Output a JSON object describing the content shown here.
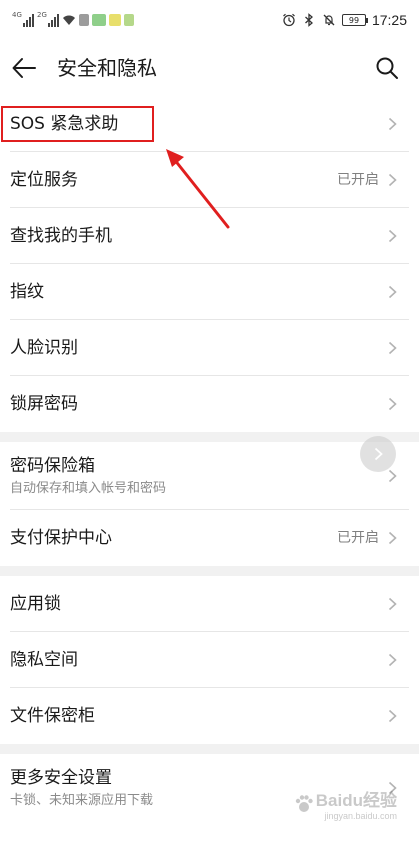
{
  "status_bar": {
    "sim1_tag": "4G",
    "sim2_tag": "2G",
    "battery": "99",
    "time": "17:25",
    "icons": [
      "alarm-icon",
      "bluetooth-icon",
      "mute-icon",
      "battery-icon"
    ]
  },
  "header": {
    "title": "安全和隐私",
    "back_icon": "arrow-left-icon",
    "search_icon": "search-icon"
  },
  "sections": [
    {
      "items": [
        {
          "label": "SOS 紧急求助",
          "value": "",
          "sub": ""
        },
        {
          "label": "定位服务",
          "value": "已开启",
          "sub": ""
        },
        {
          "label": "查找我的手机",
          "value": "",
          "sub": ""
        },
        {
          "label": "指纹",
          "value": "",
          "sub": ""
        },
        {
          "label": "人脸识别",
          "value": "",
          "sub": ""
        },
        {
          "label": "锁屏密码",
          "value": "",
          "sub": ""
        }
      ]
    },
    {
      "items": [
        {
          "label": "密码保险箱",
          "value": "",
          "sub": "自动保存和填入帐号和密码"
        },
        {
          "label": "支付保护中心",
          "value": "已开启",
          "sub": ""
        }
      ]
    },
    {
      "items": [
        {
          "label": "应用锁",
          "value": "",
          "sub": ""
        },
        {
          "label": "隐私空间",
          "value": "",
          "sub": ""
        },
        {
          "label": "文件保密柜",
          "value": "",
          "sub": ""
        }
      ]
    },
    {
      "items": [
        {
          "label": "更多安全设置",
          "value": "",
          "sub": "卡锁、未知来源应用下载"
        }
      ]
    }
  ],
  "watermark": {
    "brand": "Baidu经验",
    "url": "jingyan.baidu.com"
  },
  "colors": {
    "annotation": "#e01f1f",
    "text_primary": "#1a1a1a",
    "text_secondary": "#808080",
    "divider": "#e6e6e6",
    "section_gap": "#f1f1f1"
  }
}
